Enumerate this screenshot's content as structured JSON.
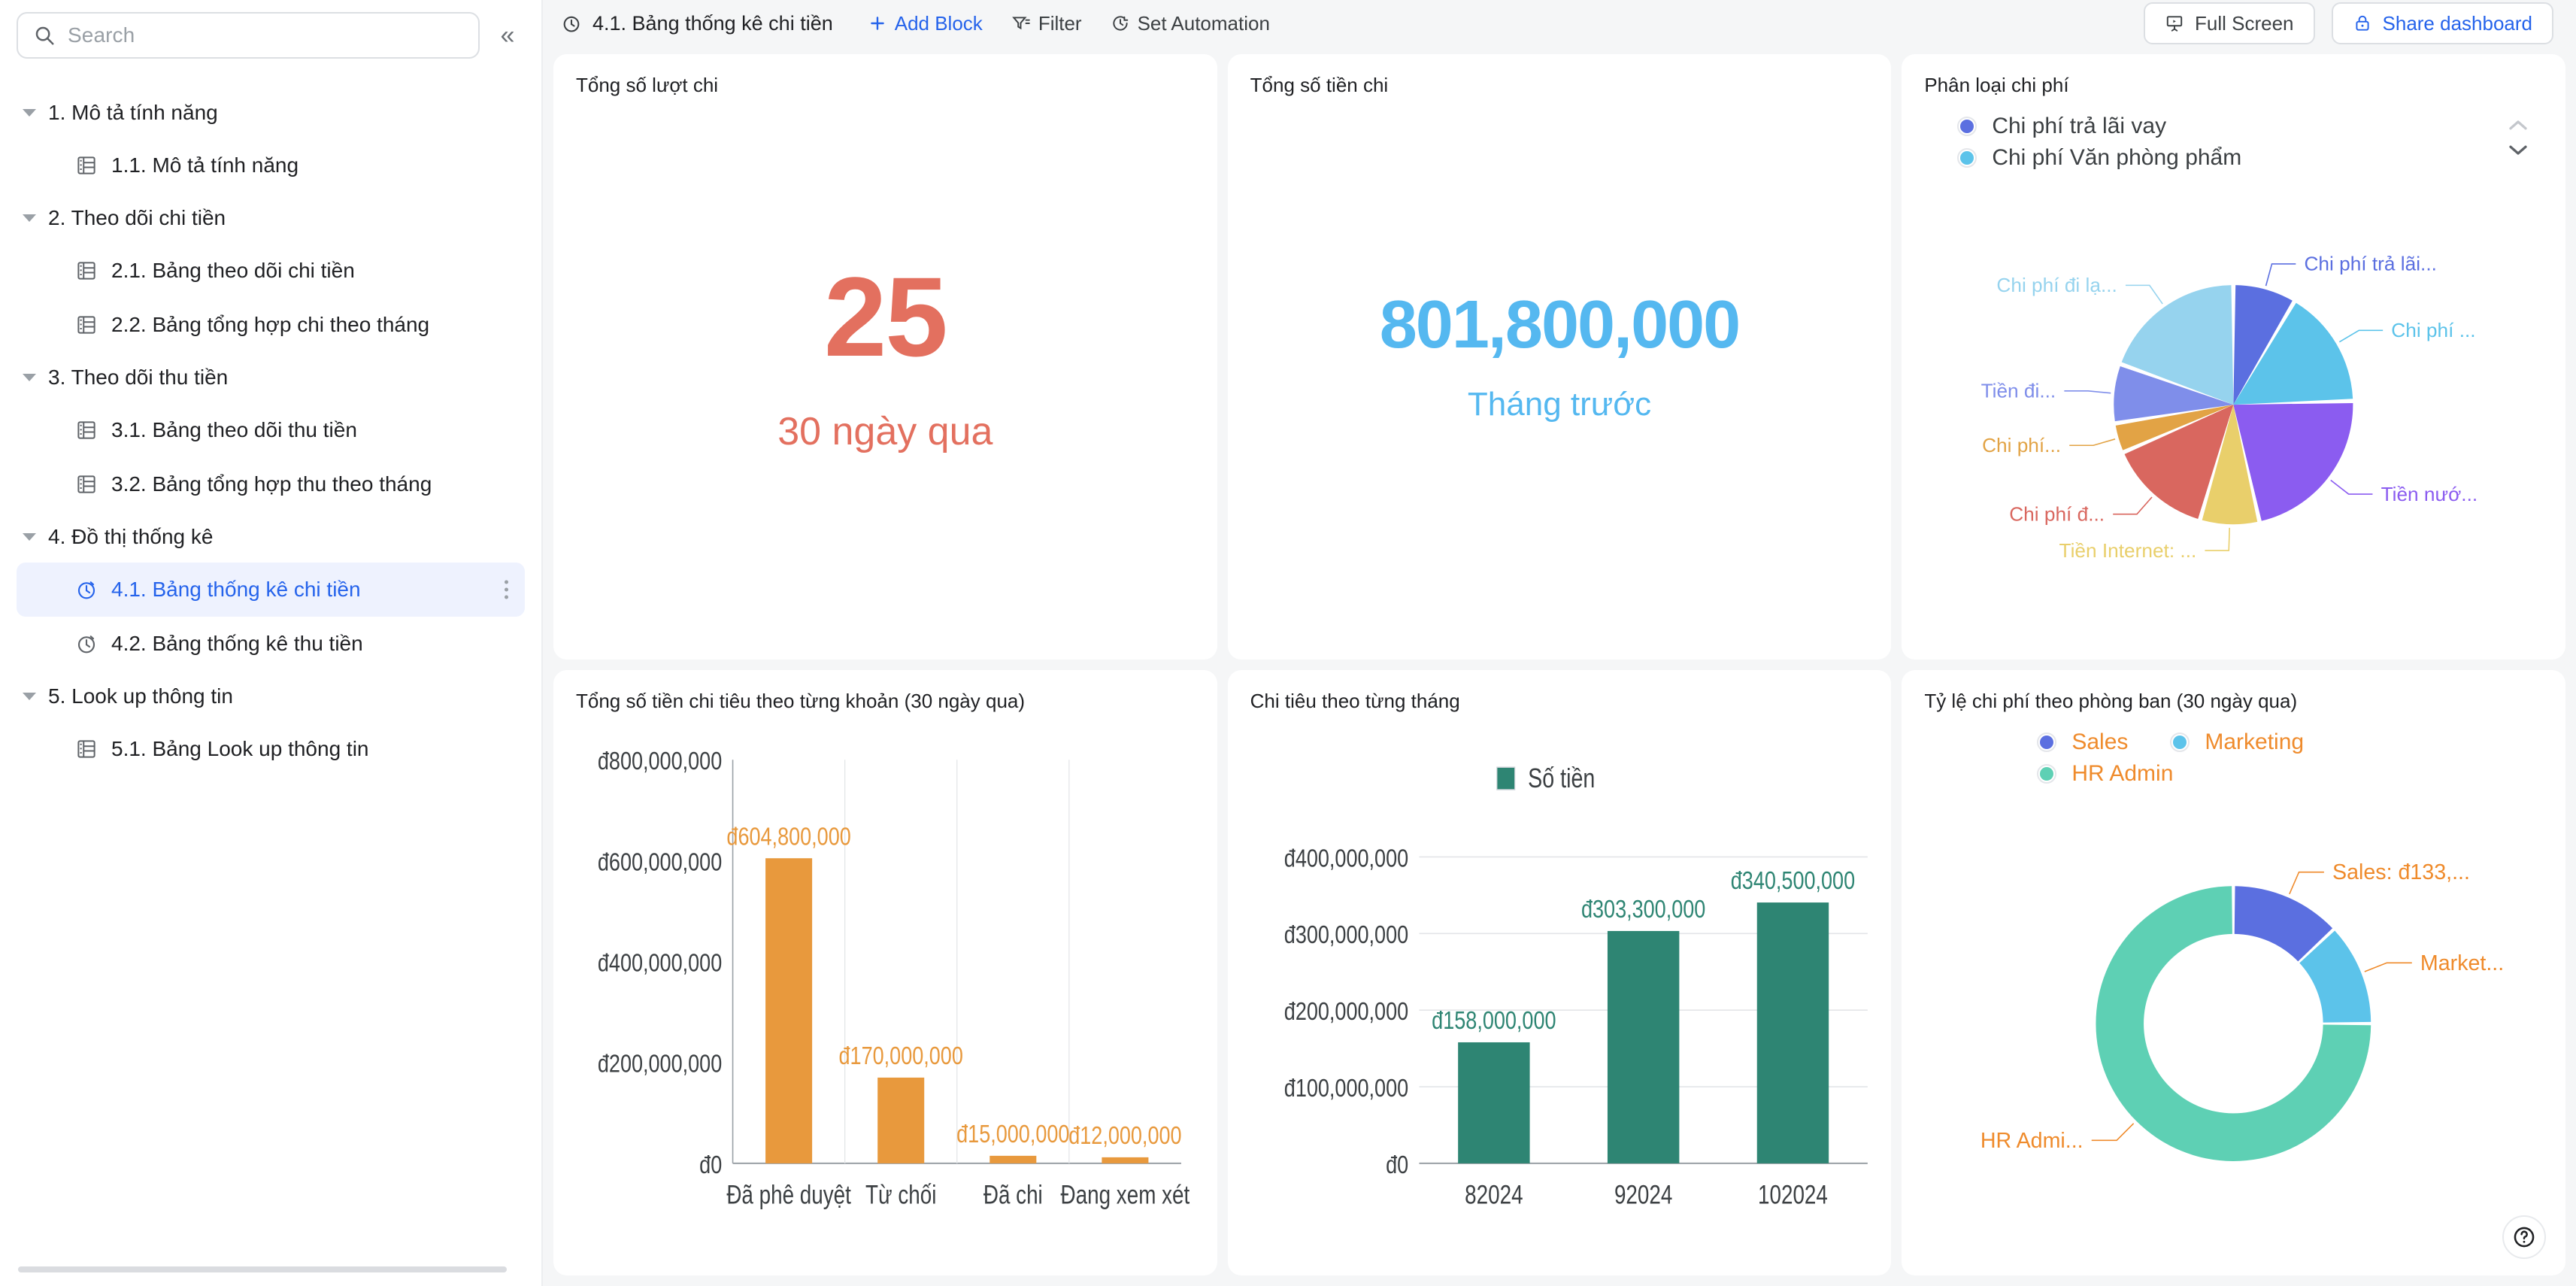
{
  "sidebar": {
    "search": {
      "placeholder": "Search",
      "icon": "search-icon"
    },
    "collapse_label": "«",
    "groups": [
      {
        "label": "1. Mô tả tính năng",
        "children": [
          {
            "label": "1.1. Mô tả tính năng",
            "icon": "table-icon",
            "active": false
          }
        ]
      },
      {
        "label": "2. Theo dõi chi tiền",
        "children": [
          {
            "label": "2.1. Bảng theo dõi chi tiền",
            "icon": "table-icon",
            "active": false
          },
          {
            "label": "2.2. Bảng tổng hợp chi theo tháng",
            "icon": "table-icon",
            "active": false
          }
        ]
      },
      {
        "label": "3. Theo dõi thu tiền",
        "children": [
          {
            "label": "3.1. Bảng theo dõi thu tiền",
            "icon": "table-icon",
            "active": false
          },
          {
            "label": "3.2. Bảng tổng hợp thu theo tháng",
            "icon": "table-icon",
            "active": false
          }
        ]
      },
      {
        "label": "4. Đồ thị thống kê",
        "children": [
          {
            "label": "4.1. Bảng thống kê chi tiền",
            "icon": "dashboard-clock-icon",
            "active": true
          },
          {
            "label": "4.2. Bảng thống kê thu tiền",
            "icon": "dashboard-clock-icon",
            "active": false
          }
        ]
      },
      {
        "label": "5. Look up thông tin",
        "children": [
          {
            "label": "5.1. Bảng Look up thông tin",
            "icon": "table-icon",
            "active": false
          }
        ]
      }
    ]
  },
  "toolbar": {
    "title": "4.1. Bảng thống kê chi tiền",
    "title_icon": "dashboard-clock-icon",
    "add_block": "Add Block",
    "filter": "Filter",
    "set_automation": "Set Automation",
    "full_screen": "Full Screen",
    "share_dashboard": "Share dashboard"
  },
  "cards": {
    "total_count": {
      "title": "Tổng số lượt chi",
      "value": "25",
      "subtitle": "30 ngày qua",
      "color": "#e3705f"
    },
    "total_amount": {
      "title": "Tổng số tiền chi",
      "value": "801,800,000",
      "subtitle": "Tháng trước",
      "color": "#55b8f0"
    },
    "pie": {
      "title": "Phân loại chi phí"
    },
    "bar_by_status": {
      "title": "Tổng số tiền chi tiêu theo từng khoản (30 ngày qua)"
    },
    "bar_by_month": {
      "title": "Chi tiêu theo từng tháng"
    },
    "donut": {
      "title": "Tỷ lệ chi phí theo phòng ban (30 ngày qua)"
    }
  },
  "help_button": {
    "icon": "question-mark-icon",
    "label": "?"
  },
  "chart_data": [
    {
      "id": "pie-expense-category",
      "type": "pie",
      "title": "Phân loại chi phí",
      "legend_position": "top",
      "legend": [
        {
          "label": "Chi phí trả lãi vay",
          "color": "#5b6fe0"
        },
        {
          "label": "Chi phí Văn phòng phẩm",
          "color": "#5cc3ea"
        }
      ],
      "categories": [
        "Chi phí trả lãi...",
        "Chi phí ...",
        "Tiền nướ...",
        "Tiền Internet: ...",
        "Chi phí đ...",
        "Chi phí...",
        "Tiền đi...",
        "Chi phí đi lạ..."
      ],
      "values": [
        8.5,
        16,
        22,
        8,
        14,
        4,
        8,
        19.5
      ],
      "colors": [
        "#5b6fe0",
        "#5cc3ea",
        "#8b5cf0",
        "#e9cf6b",
        "#d9675f",
        "#e2a345",
        "#7f8eea",
        "#96d3ee"
      ],
      "labels": [
        {
          "text": "Chi phí trả lãi...",
          "color": "#5b6fe0"
        },
        {
          "text": "Chi phí ...",
          "color": "#5cc3ea"
        },
        {
          "text": "Tiền nướ...",
          "color": "#8b5cf0"
        },
        {
          "text": "Tiền Internet: ...",
          "color": "#e9cf6b"
        },
        {
          "text": "Chi phí đ...",
          "color": "#d9675f"
        },
        {
          "text": "Chi phí...",
          "color": "#e2a345"
        },
        {
          "text": "Tiền đi...",
          "color": "#7f8eea"
        },
        {
          "text": "Chi phí đi lạ...",
          "color": "#96d3ee"
        }
      ]
    },
    {
      "id": "bar-expense-by-status",
      "type": "bar",
      "title": "Tổng số tiền chi tiêu theo từng khoản (30 ngày qua)",
      "categories": [
        "Đã phê duyệt",
        "Từ chối",
        "Đã chi",
        "Đang xem xét"
      ],
      "values": [
        604800000,
        170000000,
        15000000,
        12000000
      ],
      "data_labels": [
        "đ604,800,000",
        "đ170,000,000",
        "đ15,000,000",
        "đ12,000,000"
      ],
      "ytick_labels": [
        "đ0",
        "đ200,000,000",
        "đ400,000,000",
        "đ600,000,000",
        "đ800,000,000"
      ],
      "ytick_values": [
        0,
        200000000,
        400000000,
        600000000,
        800000000
      ],
      "ylim": [
        0,
        800000000
      ],
      "xlabel": "",
      "ylabel": "",
      "bar_color": "#e8993d",
      "label_color": "#e8993d",
      "grid": "vertical"
    },
    {
      "id": "bar-expense-by-month",
      "type": "bar",
      "title": "Chi tiêu theo từng tháng",
      "legend": [
        {
          "label": "Số tiền",
          "color": "#2e8573"
        }
      ],
      "legend_position": "top",
      "categories": [
        "82024",
        "92024",
        "102024"
      ],
      "values": [
        158000000,
        303300000,
        340500000
      ],
      "data_labels": [
        "đ158,000,000",
        "đ303,300,000",
        "đ340,500,000"
      ],
      "ytick_labels": [
        "đ0",
        "đ100,000,000",
        "đ200,000,000",
        "đ300,000,000",
        "đ400,000,000"
      ],
      "ytick_values": [
        0,
        100000000,
        200000000,
        300000000,
        400000000
      ],
      "ylim": [
        0,
        400000000
      ],
      "xlabel": "",
      "ylabel": "",
      "bar_color": "#2e8573",
      "label_color": "#2e8573",
      "grid": "horizontal"
    },
    {
      "id": "donut-expense-by-department",
      "type": "pie",
      "variant": "donut",
      "title": "Tỷ lệ chi phí theo phòng ban (30 ngày qua)",
      "legend_position": "top",
      "legend": [
        {
          "label": "Sales",
          "color": "#5b6fe0"
        },
        {
          "label": "Marketing",
          "color": "#5cc3ea"
        },
        {
          "label": "HR Admin",
          "color": "#5ed0b4"
        }
      ],
      "categories": [
        "Sales",
        "Marketing",
        "HR Admin"
      ],
      "values": [
        13,
        12,
        75
      ],
      "colors": [
        "#5b6fe0",
        "#5cc3ea",
        "#5ed0b4"
      ],
      "labels": [
        {
          "text": "Sales: đ133,...",
          "color": "#ef8b2c"
        },
        {
          "text": "Market...",
          "color": "#ef8b2c"
        },
        {
          "text": "HR Admi...",
          "color": "#ef8b2c"
        }
      ]
    }
  ]
}
